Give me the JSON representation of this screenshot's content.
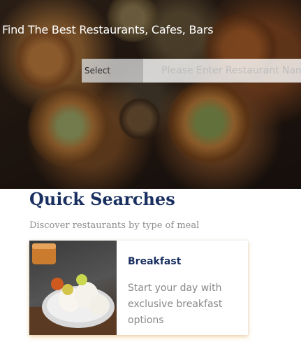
{
  "hero": {
    "title": "Find The Best Restaurants, Cafes, Bars",
    "select_label": "Select",
    "search_placeholder": "Please Enter Restaurant Name"
  },
  "quick_searches": {
    "title": "Quick Searches",
    "subtitle": "Discover restaurants by type of meal",
    "cards": [
      {
        "title": "Breakfast",
        "description": "Start your day with exclusive breakfast options"
      }
    ]
  },
  "colors": {
    "heading": "#192f60",
    "muted_text": "#8c8c8c",
    "card_shadow": "#e6aa50"
  }
}
